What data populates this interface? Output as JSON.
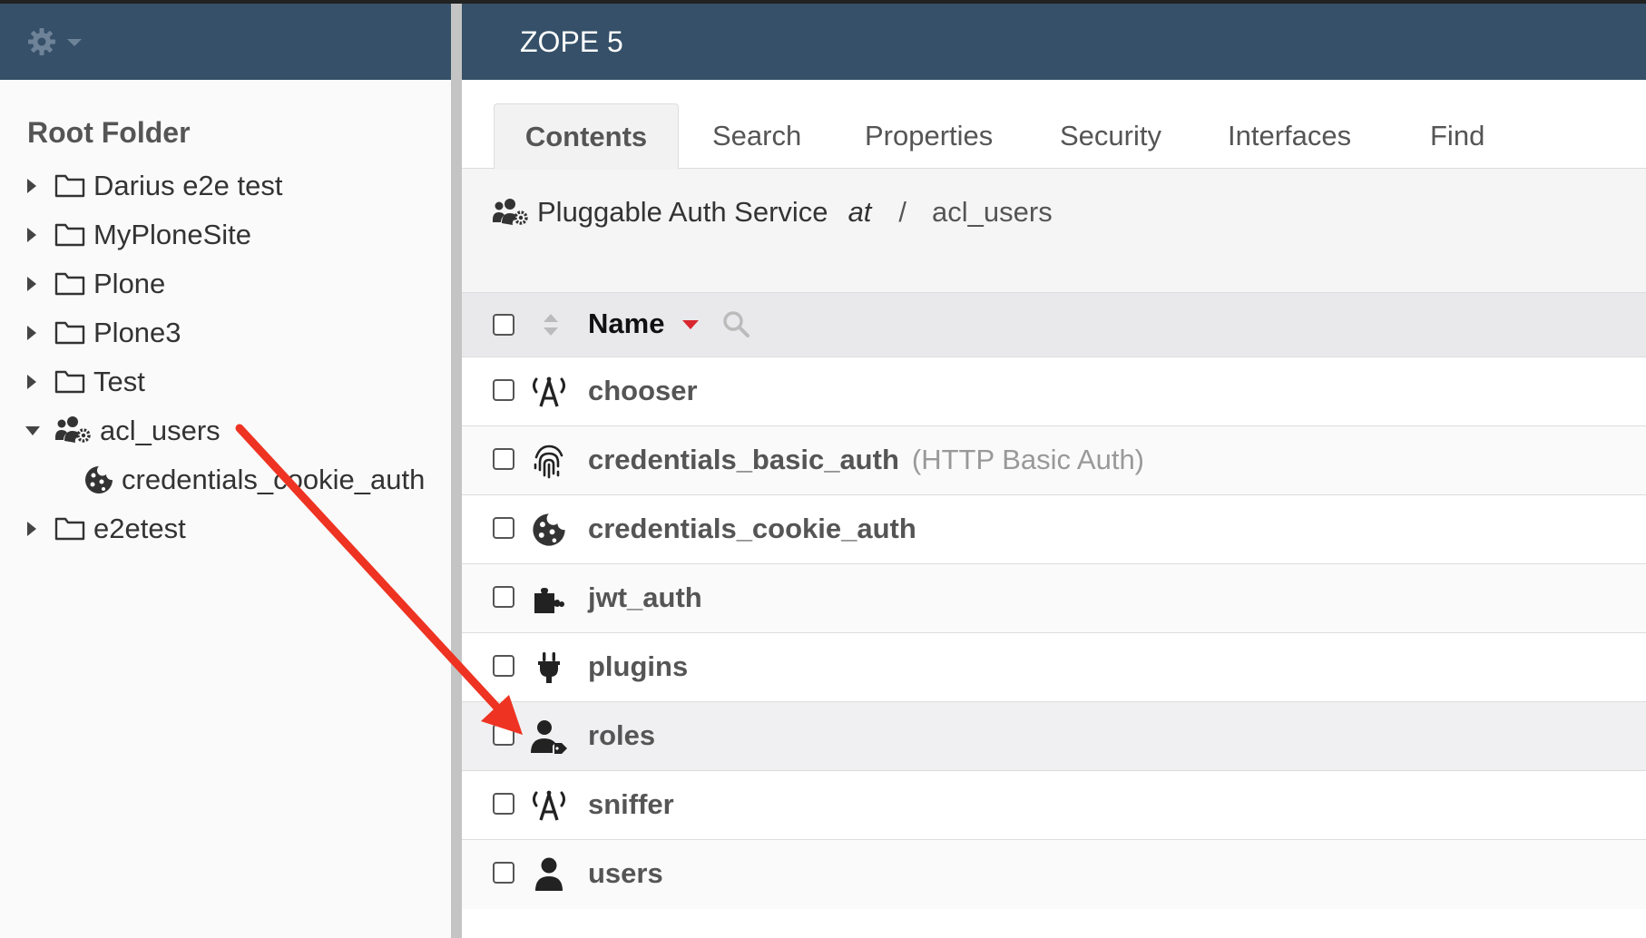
{
  "colors": {
    "header_bg": "#355068",
    "arrow": "#ee3322"
  },
  "app": {
    "title": "ZOPE 5",
    "settings_icon": "gear-icon"
  },
  "sidebar": {
    "root_title": "Root Folder",
    "items": [
      {
        "label": "Darius e2e test",
        "icon": "folder-icon",
        "expanded": false
      },
      {
        "label": "MyPloneSite",
        "icon": "folder-icon",
        "expanded": false
      },
      {
        "label": "Plone",
        "icon": "folder-icon",
        "expanded": false
      },
      {
        "label": "Plone3",
        "icon": "folder-icon",
        "expanded": false
      },
      {
        "label": "Test",
        "icon": "folder-icon",
        "expanded": false
      },
      {
        "label": "acl_users",
        "icon": "users-cog-icon",
        "expanded": true
      },
      {
        "label": "credentials_cookie_auth",
        "icon": "cookie-icon",
        "child": true
      },
      {
        "label": "e2etest",
        "icon": "folder-icon",
        "expanded": false
      }
    ]
  },
  "tabs": [
    {
      "label": "Contents",
      "active": true
    },
    {
      "label": "Search"
    },
    {
      "label": "Properties"
    },
    {
      "label": "Security"
    },
    {
      "label": "Interfaces"
    },
    {
      "label": "Find"
    }
  ],
  "breadcrumb": {
    "meta_type": "Pluggable Auth Service",
    "at": "at",
    "separator": "/",
    "path": "acl_users"
  },
  "table": {
    "column_name": "Name",
    "rows": [
      {
        "name": "chooser",
        "icon": "broadcast-icon",
        "desc": ""
      },
      {
        "name": "credentials_basic_auth",
        "icon": "fingerprint-icon",
        "desc": "(HTTP Basic Auth)"
      },
      {
        "name": "credentials_cookie_auth",
        "icon": "cookie-icon",
        "desc": ""
      },
      {
        "name": "jwt_auth",
        "icon": "puzzle-icon",
        "desc": ""
      },
      {
        "name": "plugins",
        "icon": "plug-icon",
        "desc": ""
      },
      {
        "name": "roles",
        "icon": "user-tag-icon",
        "desc": ""
      },
      {
        "name": "sniffer",
        "icon": "broadcast-icon",
        "desc": ""
      },
      {
        "name": "users",
        "icon": "user-icon",
        "desc": ""
      }
    ]
  }
}
